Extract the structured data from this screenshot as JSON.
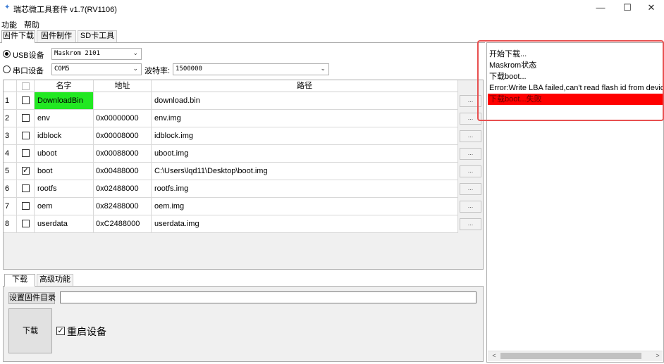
{
  "window": {
    "title": "瑞芯微工具套件 v1.7(RV1106)",
    "min_glyph": "—",
    "max_glyph": "☐",
    "close_glyph": "✕"
  },
  "menu": {
    "func": "功能",
    "help": "帮助"
  },
  "tabs": {
    "download": "固件下载",
    "firmware": "固件制作",
    "sd": "SD卡工具"
  },
  "device": {
    "usb_label": "USB设备",
    "usb_selected": true,
    "usb_combo": "Maskrom  2101",
    "serial_label": "串口设备",
    "serial_combo": "COM5",
    "baud_label": "波特率:",
    "baud_value": "1500000",
    "arrow": "⌄"
  },
  "table": {
    "headers": {
      "name": "名字",
      "addr": "地址",
      "path": "路径"
    },
    "dots": "...",
    "rows": [
      {
        "idx": "1",
        "checked": false,
        "name": "DownloadBin",
        "addr": "",
        "path": "download.bin",
        "highlight": true
      },
      {
        "idx": "2",
        "checked": false,
        "name": "env",
        "addr": "0x00000000",
        "path": "env.img"
      },
      {
        "idx": "3",
        "checked": false,
        "name": "idblock",
        "addr": "0x00008000",
        "path": "idblock.img"
      },
      {
        "idx": "4",
        "checked": false,
        "name": "uboot",
        "addr": "0x00088000",
        "path": "uboot.img"
      },
      {
        "idx": "5",
        "checked": true,
        "name": "boot",
        "addr": "0x00488000",
        "path": "C:\\Users\\lqd11\\Desktop\\boot.img"
      },
      {
        "idx": "6",
        "checked": false,
        "name": "rootfs",
        "addr": "0x02488000",
        "path": "rootfs.img"
      },
      {
        "idx": "7",
        "checked": false,
        "name": "oem",
        "addr": "0x82488000",
        "path": "oem.img"
      },
      {
        "idx": "8",
        "checked": false,
        "name": "userdata",
        "addr": "0xC2488000",
        "path": "userdata.img"
      }
    ]
  },
  "bottom": {
    "tab_download": "下载",
    "tab_advanced": "高级功能",
    "set_dir_button": "设置固件目录",
    "dir_value": "",
    "download_button": "下载",
    "restart_label": "重启设备",
    "restart_checked": true
  },
  "log": {
    "lines": [
      "开始下载...",
      "Maskrom状态",
      "下载boot...",
      "Error:Write LBA failed,can't read flash id from device",
      "下载boot...失败"
    ],
    "scroll_left": "<",
    "scroll_right": ">"
  },
  "colors": {
    "highlight_green": "#22e822",
    "error_red": "#ff0000",
    "annotation_box": "#e85050"
  }
}
